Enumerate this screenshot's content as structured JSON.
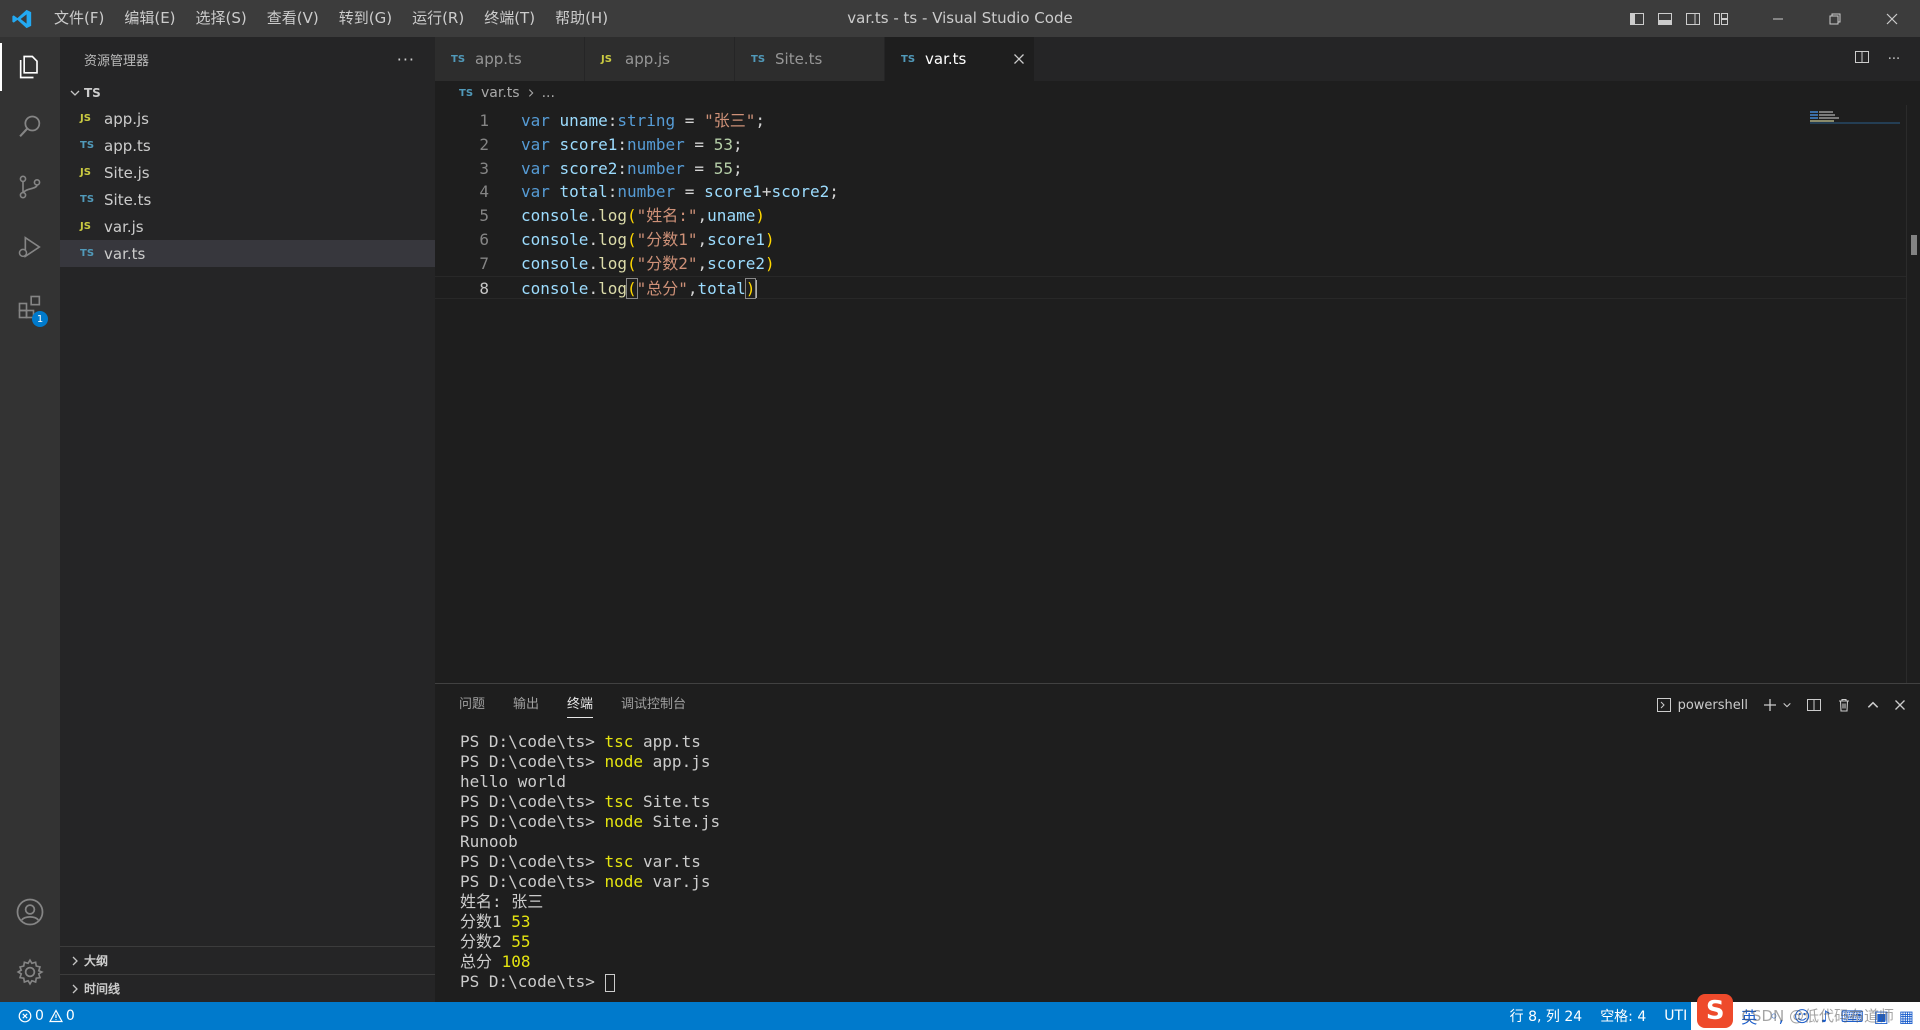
{
  "titlebar": {
    "window_title": "var.ts - ts - Visual Studio Code",
    "menu": [
      "文件(F)",
      "编辑(E)",
      "选择(S)",
      "查看(V)",
      "转到(G)",
      "运行(R)",
      "终端(T)",
      "帮助(H)"
    ]
  },
  "activitybar": {
    "extensions_badge": "1"
  },
  "sidebar": {
    "title": "资源管理器",
    "more": "···",
    "folder": "TS",
    "files": [
      {
        "icon": "JS",
        "name": "app.js"
      },
      {
        "icon": "TS",
        "name": "app.ts"
      },
      {
        "icon": "JS",
        "name": "Site.js"
      },
      {
        "icon": "TS",
        "name": "Site.ts"
      },
      {
        "icon": "JS",
        "name": "var.js"
      },
      {
        "icon": "TS",
        "name": "var.ts"
      }
    ],
    "outline_label": "大纲",
    "timeline_label": "时间线"
  },
  "editor": {
    "tabs": [
      {
        "icon": "TS",
        "label": "app.ts"
      },
      {
        "icon": "JS",
        "label": "app.js"
      },
      {
        "icon": "TS",
        "label": "Site.ts"
      },
      {
        "icon": "TS",
        "label": "var.ts"
      }
    ],
    "breadcrumb": {
      "icon": "TS",
      "file": "var.ts",
      "rest": "..."
    },
    "line_numbers": [
      "1",
      "2",
      "3",
      "4",
      "5",
      "6",
      "7",
      "8"
    ],
    "code": {
      "l1": {
        "kw": "var",
        "name": "uname",
        "colon": ":",
        "type": "string",
        "eq": " = ",
        "val": "\"张三\"",
        "end": ";"
      },
      "l2": {
        "kw": "var",
        "name": "score1",
        "colon": ":",
        "type": "number",
        "eq": " = ",
        "val": "53",
        "end": ";"
      },
      "l3": {
        "kw": "var",
        "name": "score2",
        "colon": ":",
        "type": "number",
        "eq": " = ",
        "val": "55",
        "end": ";"
      },
      "l4": {
        "kw": "var",
        "name": "total",
        "colon": ":",
        "type": "number",
        "eq": " = ",
        "a": "score1",
        "plus": "+",
        "b": "score2",
        "end": ";"
      },
      "l5": {
        "obj": "console",
        "dot": ".",
        "fn": "log",
        "open": "(",
        "str": "\"姓名:\"",
        "comma": ",",
        "arg": "uname",
        "close": ")"
      },
      "l6": {
        "obj": "console",
        "dot": ".",
        "fn": "log",
        "open": "(",
        "str": "\"分数1\"",
        "comma": ",",
        "arg": "score1",
        "close": ")"
      },
      "l7": {
        "obj": "console",
        "dot": ".",
        "fn": "log",
        "open": "(",
        "str": "\"分数2\"",
        "comma": ",",
        "arg": "score2",
        "close": ")"
      },
      "l8": {
        "obj": "console",
        "dot": ".",
        "fn": "log",
        "open": "(",
        "str": "\"总分\"",
        "comma": ",",
        "arg": "total",
        "close": ")"
      }
    }
  },
  "panel": {
    "tabs": [
      "问题",
      "输出",
      "终端",
      "调试控制台"
    ],
    "active_tab": "终端",
    "shell": "powershell",
    "terminal": [
      {
        "prompt": "PS D:\\code\\ts> ",
        "cmd": "tsc",
        "args": " app.ts"
      },
      {
        "prompt": "PS D:\\code\\ts> ",
        "cmd": "node",
        "args": " app.js"
      },
      {
        "text": "hello world"
      },
      {
        "prompt": "PS D:\\code\\ts> ",
        "cmd": "tsc",
        "args": " Site.ts"
      },
      {
        "prompt": "PS D:\\code\\ts> ",
        "cmd": "node",
        "args": " Site.js"
      },
      {
        "text": "Runoob"
      },
      {
        "prompt": "PS D:\\code\\ts> ",
        "cmd": "tsc",
        "args": " var.ts"
      },
      {
        "prompt": "PS D:\\code\\ts> ",
        "cmd": "node",
        "args": " var.js"
      },
      {
        "text": "姓名: 张三"
      },
      {
        "label": "分数1 ",
        "num": "53"
      },
      {
        "label": "分数2 ",
        "num": "55"
      },
      {
        "label": "总分 ",
        "num": "108"
      },
      {
        "prompt": "PS D:\\code\\ts> "
      }
    ]
  },
  "statusbar": {
    "errors": "0",
    "warnings": "0",
    "position": "行 8, 列 24",
    "spaces": "空格: 4",
    "encoding": "UTI",
    "ime_lang": "英",
    "watermark": "CSDN @低代码布道师"
  },
  "colors": {
    "accent": "#007acc",
    "titlebar": "#3c3c3c",
    "activitybar": "#333333",
    "sidebar": "#252526",
    "editor": "#1e1e1e"
  }
}
